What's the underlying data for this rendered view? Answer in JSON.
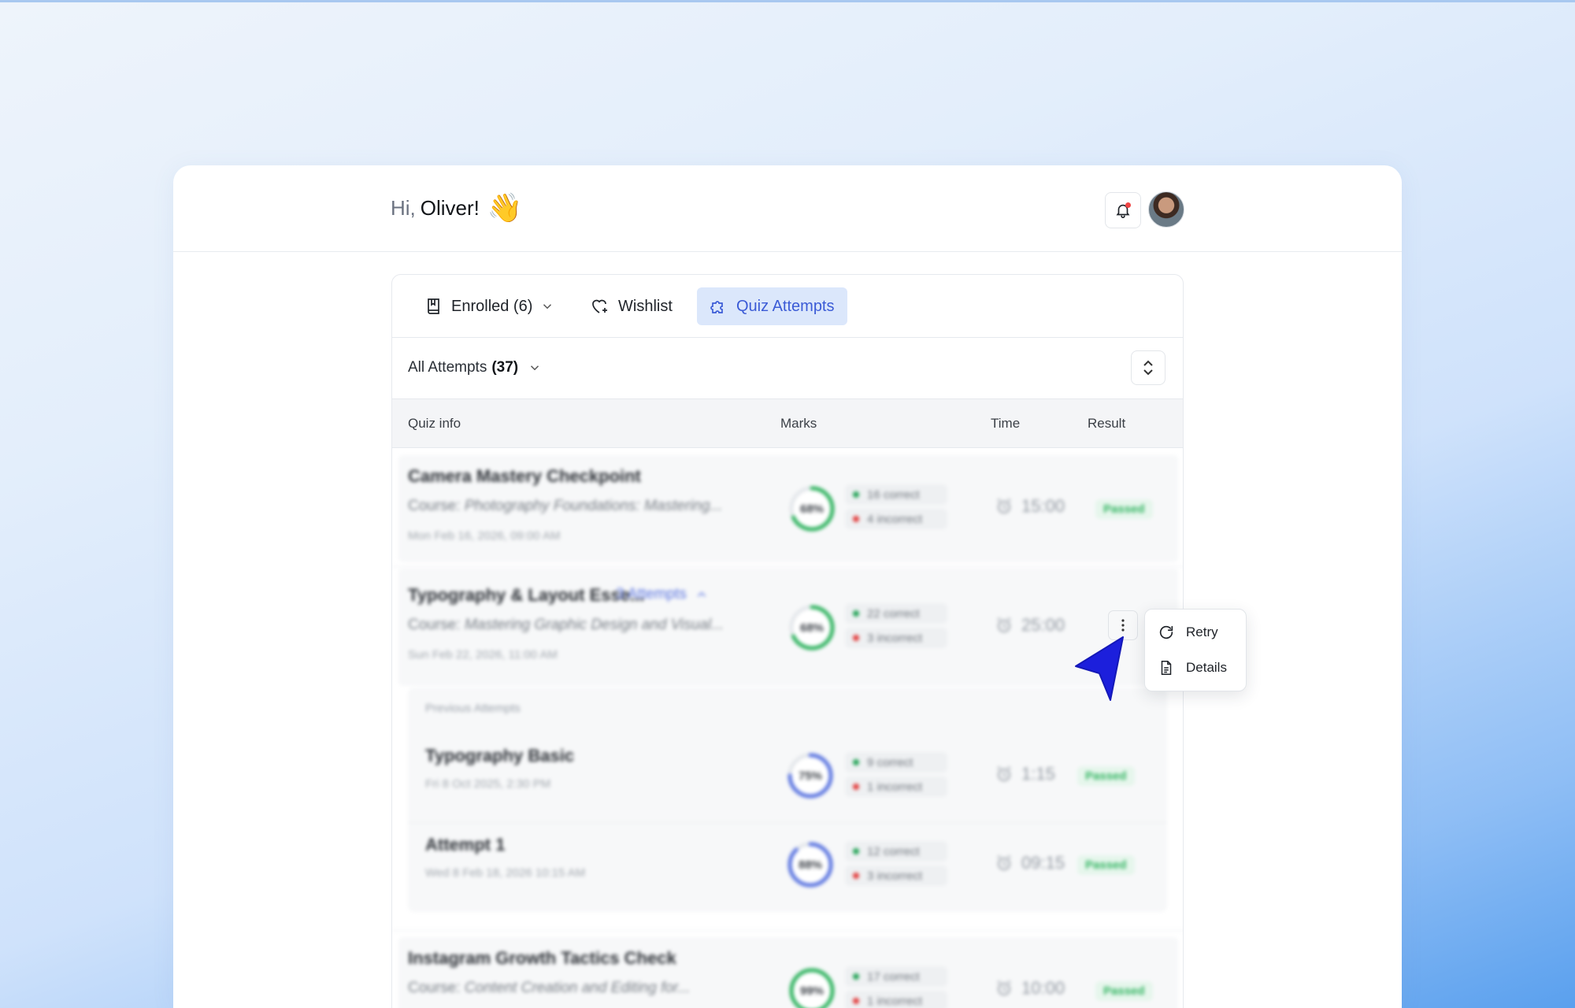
{
  "greeting": {
    "hi": "Hi,",
    "name": "Oliver!",
    "emoji": "👋"
  },
  "icons": {
    "bell": "bell-icon",
    "avatar": "user-avatar"
  },
  "colors": {
    "accent": "#3b5bd6",
    "accent_bg": "#dbe7fb",
    "pass": "#2fb35f",
    "correct": "#22a355",
    "incorrect": "#e23b3b"
  },
  "tabs": [
    {
      "label": "Enrolled (6)",
      "icon": "book-icon"
    },
    {
      "label": "Wishlist",
      "icon": "heart-plus-icon"
    },
    {
      "label": "Quiz Attempts",
      "icon": "puzzle-icon",
      "active": true
    }
  ],
  "filter": {
    "label": "All Attempts",
    "count": "(37)"
  },
  "table": {
    "headers": [
      "Quiz info",
      "Marks",
      "Time",
      "Result"
    ]
  },
  "rows": [
    {
      "title": "Camera Mastery Checkpoint",
      "course_prefix": "Course:",
      "course": "Photography Foundations: Mastering...",
      "date": "Mon Feb 16, 2026, 09:00 AM",
      "score": "68%",
      "score_value": 0.68,
      "correct": "16 correct",
      "incorrect": "4 incorrect",
      "time": "15:00",
      "result": "Passed"
    },
    {
      "title": "Typography & Layout Esse...",
      "attempts": "3 Attempts",
      "course_prefix": "Course:",
      "course": "Mastering Graphic Design and Visual...",
      "date": "Sun Feb 22, 2026, 11:00 AM",
      "score": "68%",
      "score_value": 0.68,
      "correct": "22 correct",
      "incorrect": "3 incorrect",
      "time": "25:00"
    },
    {
      "title": "Instagram Growth Tactics Check",
      "course_prefix": "Course:",
      "course": "Content Creation and Editing for...",
      "score": "99%",
      "score_value": 0.99,
      "correct": "17 correct",
      "incorrect": "1 incorrect",
      "time": "10:00",
      "result": "Passed"
    }
  ],
  "previous": {
    "title": "Previous Attempts",
    "items": [
      {
        "title": "Typography Basic",
        "date": "Fri 8 Oct 2025, 2:30 PM",
        "score": "75%",
        "score_value": 0.75,
        "correct": "9 correct",
        "incorrect": "1 incorrect",
        "time": "1:15",
        "result": "Passed"
      },
      {
        "title": "Attempt 1",
        "date": "Wed 8 Feb 18, 2026 10:15 AM",
        "score": "88%",
        "score_value": 0.88,
        "correct": "12 correct",
        "incorrect": "3 incorrect",
        "time": "09:15",
        "result": "Passed"
      }
    ]
  },
  "menu": {
    "retry": "Retry",
    "details": "Details"
  }
}
